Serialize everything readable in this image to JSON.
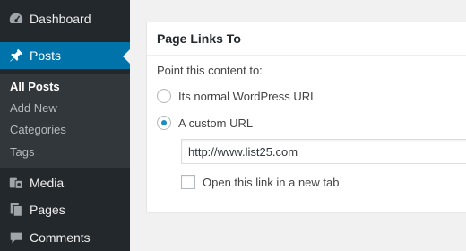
{
  "sidebar": {
    "items": [
      {
        "label": "Dashboard",
        "icon": "dashboard-icon"
      },
      {
        "label": "Posts",
        "icon": "pin-icon",
        "active": true
      },
      {
        "label": "Media",
        "icon": "media-icon"
      },
      {
        "label": "Pages",
        "icon": "pages-icon"
      },
      {
        "label": "Comments",
        "icon": "comments-icon"
      }
    ],
    "submenu": [
      {
        "label": "All Posts",
        "current": true
      },
      {
        "label": "Add New"
      },
      {
        "label": "Categories"
      },
      {
        "label": "Tags"
      }
    ]
  },
  "metabox": {
    "title": "Page Links To",
    "prompt": "Point this content to:",
    "options": [
      {
        "label": "Its normal WordPress URL",
        "selected": false
      },
      {
        "label": "A custom URL",
        "selected": true
      }
    ],
    "url_value": "http://www.list25.com",
    "new_tab_label": "Open this link in a new tab",
    "new_tab_checked": false
  },
  "colors": {
    "sidebar_bg": "#23282d",
    "submenu_bg": "#32373c",
    "active_bg": "#0073aa",
    "radio_dot": "#1e8cbe",
    "page_bg": "#f1f1f1"
  }
}
